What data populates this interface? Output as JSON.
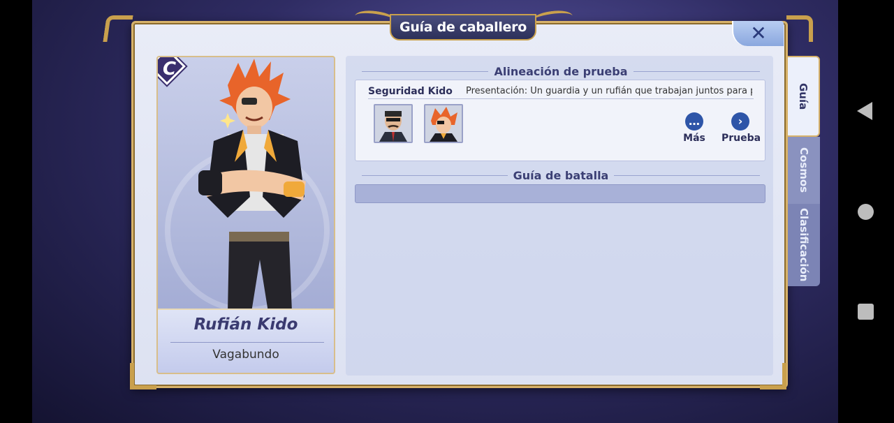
{
  "dialog": {
    "title": "Guía de caballero"
  },
  "character": {
    "rank": "C",
    "name": "Rufián Kido",
    "class": "Vagabundo"
  },
  "lineup": {
    "heading": "Alineación de prueba",
    "team_name": "Seguridad Kido",
    "description": "Presentación: Un guardia y un rufián que trabajan juntos para prote...",
    "more_label": "Más",
    "test_label": "Prueba"
  },
  "battle": {
    "heading": "Guía de batalla"
  },
  "tabs": [
    {
      "label": "Guía",
      "active": true
    },
    {
      "label": "Cosmos",
      "active": false
    },
    {
      "label": "Clasificación",
      "active": false
    }
  ]
}
